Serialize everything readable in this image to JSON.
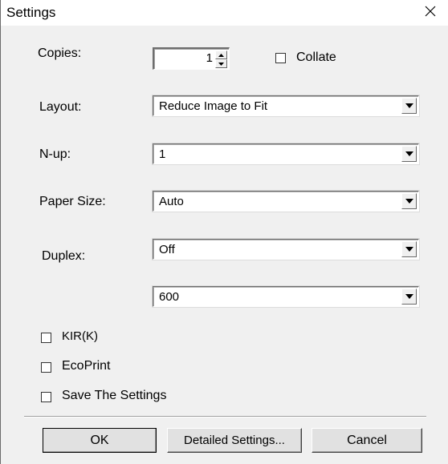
{
  "window": {
    "title": "Settings",
    "close_icon": "close-icon"
  },
  "copies": {
    "label": "Copies:",
    "value": "1",
    "up_icon": "spinner-up-icon",
    "down_icon": "spinner-down-icon"
  },
  "collate": {
    "label": "Collate",
    "checked": false
  },
  "layout": {
    "label": "Layout:",
    "value": "Reduce Image to Fit"
  },
  "nup": {
    "label": "N-up:",
    "value": "1"
  },
  "paper_size": {
    "label": "Paper Size:",
    "value": "Auto"
  },
  "duplex": {
    "label": "Duplex:",
    "value": "Off"
  },
  "resolution": {
    "value": "600"
  },
  "kir": {
    "label": "KIR(K)",
    "checked": false
  },
  "ecoprint": {
    "label": "EcoPrint",
    "checked": false
  },
  "save_settings": {
    "label": "Save The Settings",
    "checked": false
  },
  "buttons": {
    "ok": "OK",
    "detailed": "Detailed Settings...",
    "cancel": "Cancel"
  }
}
